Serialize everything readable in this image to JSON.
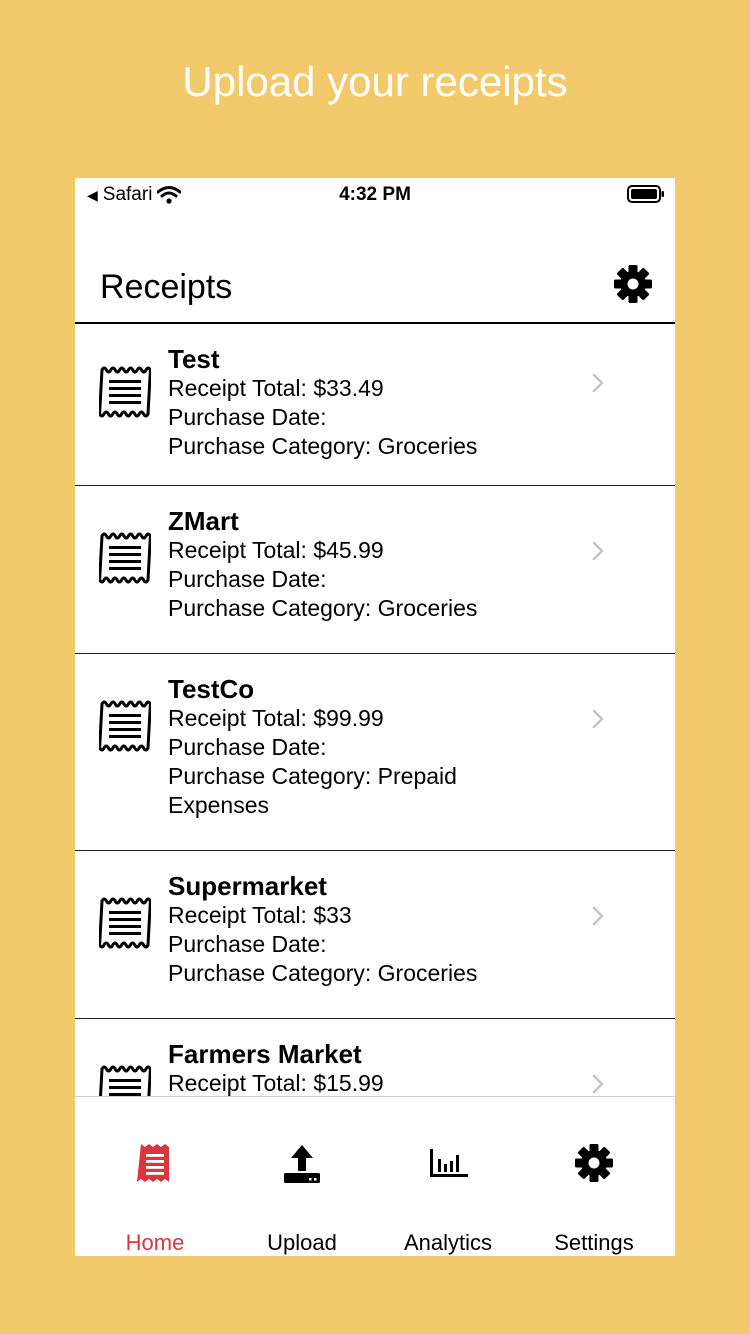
{
  "headline": "Upload your receipts",
  "status_bar": {
    "back_app": "Safari",
    "time": "4:32 PM"
  },
  "nav": {
    "title": "Receipts",
    "settings_icon": "gear-icon"
  },
  "receipts": [
    {
      "title": "Test",
      "total": "Receipt Total: $33.49",
      "date": "Purchase Date:",
      "category_line1": "Purchase Category: Groceries",
      "category_line2": ""
    },
    {
      "title": "ZMart",
      "total": "Receipt Total: $45.99",
      "date": "Purchase Date:",
      "category_line1": "Purchase Category: Groceries",
      "category_line2": ""
    },
    {
      "title": "TestCo",
      "total": "Receipt Total: $99.99",
      "date": "Purchase Date:",
      "category_line1": "Purchase Category: Prepaid",
      "category_line2": "Expenses"
    },
    {
      "title": "Supermarket",
      "total": "Receipt Total: $33",
      "date": "Purchase Date:",
      "category_line1": "Purchase Category: Groceries",
      "category_line2": ""
    },
    {
      "title": "Farmers Market",
      "total": "Receipt Total: $15.99",
      "date": "",
      "category_line1": "",
      "category_line2": ""
    }
  ],
  "tabs": [
    {
      "label": "Home",
      "icon": "receipt-icon",
      "active": true
    },
    {
      "label": "Upload",
      "icon": "upload-icon",
      "active": false
    },
    {
      "label": "Analytics",
      "icon": "bar-chart-icon",
      "active": false
    },
    {
      "label": "Settings",
      "icon": "gear-icon",
      "active": false
    }
  ],
  "colors": {
    "background": "#F2C96B",
    "accent": "#D9363E",
    "text": "#000000"
  }
}
